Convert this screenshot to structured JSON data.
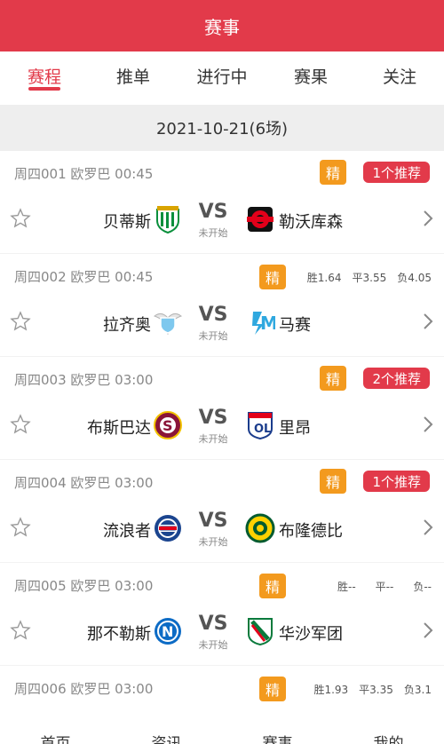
{
  "header": {
    "title": "赛事"
  },
  "tabs": [
    {
      "label": "赛程",
      "active": true
    },
    {
      "label": "推单"
    },
    {
      "label": "进行中"
    },
    {
      "label": "赛果"
    },
    {
      "label": "关注"
    }
  ],
  "date_label": "2021-10-21(6场)",
  "matches": [
    {
      "meta": "周四001 欧罗巴 00:45",
      "jing": "精",
      "rec": "1个推荐",
      "home": "贝蒂斯",
      "away": "勒沃库森",
      "vs": "VS",
      "status": "未开始",
      "home_logo": "betis-logo",
      "away_logo": "leverkusen-logo"
    },
    {
      "meta": "周四002 欧罗巴 00:45",
      "jing": "精",
      "odds": {
        "win": "胜1.64",
        "draw": "平3.55",
        "lose": "负4.05"
      },
      "home": "拉齐奥",
      "away": "马赛",
      "vs": "VS",
      "status": "未开始",
      "home_logo": "lazio-logo",
      "away_logo": "marseille-logo"
    },
    {
      "meta": "周四003 欧罗巴 03:00",
      "jing": "精",
      "rec": "2个推荐",
      "home": "布斯巴达",
      "away": "里昂",
      "vs": "VS",
      "status": "未开始",
      "home_logo": "sparta-logo",
      "away_logo": "lyon-logo"
    },
    {
      "meta": "周四004 欧罗巴 03:00",
      "jing": "精",
      "rec": "1个推荐",
      "home": "流浪者",
      "away": "布隆德比",
      "vs": "VS",
      "status": "未开始",
      "home_logo": "rangers-logo",
      "away_logo": "brondby-logo"
    },
    {
      "meta": "周四005 欧罗巴 03:00",
      "jing": "精",
      "odds": {
        "win": "胜--",
        "draw": "平--",
        "lose": "负--"
      },
      "home": "那不勒斯",
      "away": "华沙军团",
      "vs": "VS",
      "status": "未开始",
      "home_logo": "napoli-logo",
      "away_logo": "legia-logo"
    },
    {
      "meta": "周四006 欧罗巴 03:00",
      "jing": "精",
      "odds": {
        "win": "胜1.93",
        "draw": "平3.35",
        "lose": "负3.1"
      }
    }
  ],
  "bottom_nav": [
    "首页",
    "资讯",
    "赛事",
    "我的"
  ],
  "colors": {
    "brand": "#e23a4a",
    "jing": "#f39a1e"
  }
}
